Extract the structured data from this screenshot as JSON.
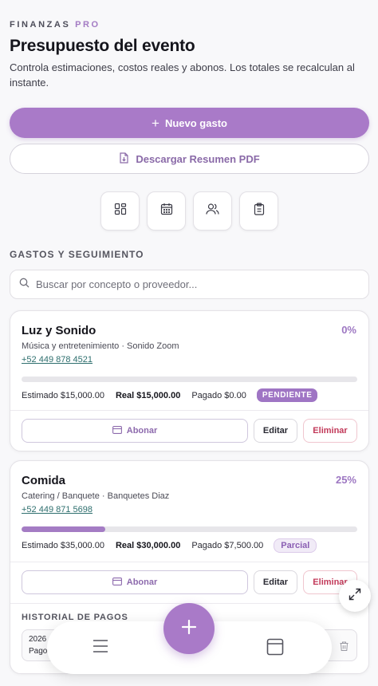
{
  "header": {
    "brand_main": "FINANZAS",
    "brand_accent": "PRO",
    "title": "Presupuesto del evento",
    "subtitle": "Controla estimaciones, costos reales y abonos. Los totales se recalculan al instante."
  },
  "actions": {
    "new_expense_label": "Nuevo gasto",
    "download_pdf_label": "Descargar Resumen PDF"
  },
  "toolbar": {
    "icons": [
      "dashboard-icon",
      "calendar-icon",
      "users-icon",
      "clipboard-icon"
    ]
  },
  "expenses": {
    "section_label": "GASTOS Y SEGUIMIENTO",
    "search_placeholder": "Buscar por concepto o proveedor...",
    "items": [
      {
        "concept": "Luz y Sonido",
        "percent": "0%",
        "progress_fraction": 0.0,
        "category_provider": "Música y entretenimiento · Sonido Zoom",
        "phone": "+52 449 878 4521",
        "estimated": "Estimado $15,000.00",
        "real": "Real $15,000.00",
        "paid": "Pagado $0.00",
        "status": "PENDIENTE"
      },
      {
        "concept": "Comida",
        "percent": "25%",
        "progress_fraction": 0.25,
        "category_provider": "Catering / Banquete · Banquetes Diaz",
        "phone": "+52 449 871 5698",
        "estimated": "Estimado $35,000.00",
        "real": "Real $30,000.00",
        "paid": "Pagado $7,500.00",
        "status": "Parcial"
      }
    ],
    "buttons": {
      "pay": "Abonar",
      "edit": "Editar",
      "delete": "Eliminar"
    },
    "history": {
      "label": "HISTORIAL DE PAGOS",
      "rows": [
        {
          "date": "2026",
          "method": "Pago"
        }
      ]
    }
  },
  "colors": {
    "accent": "#a97ac8",
    "danger": "#c23a5a",
    "link": "#2e6f6e"
  }
}
